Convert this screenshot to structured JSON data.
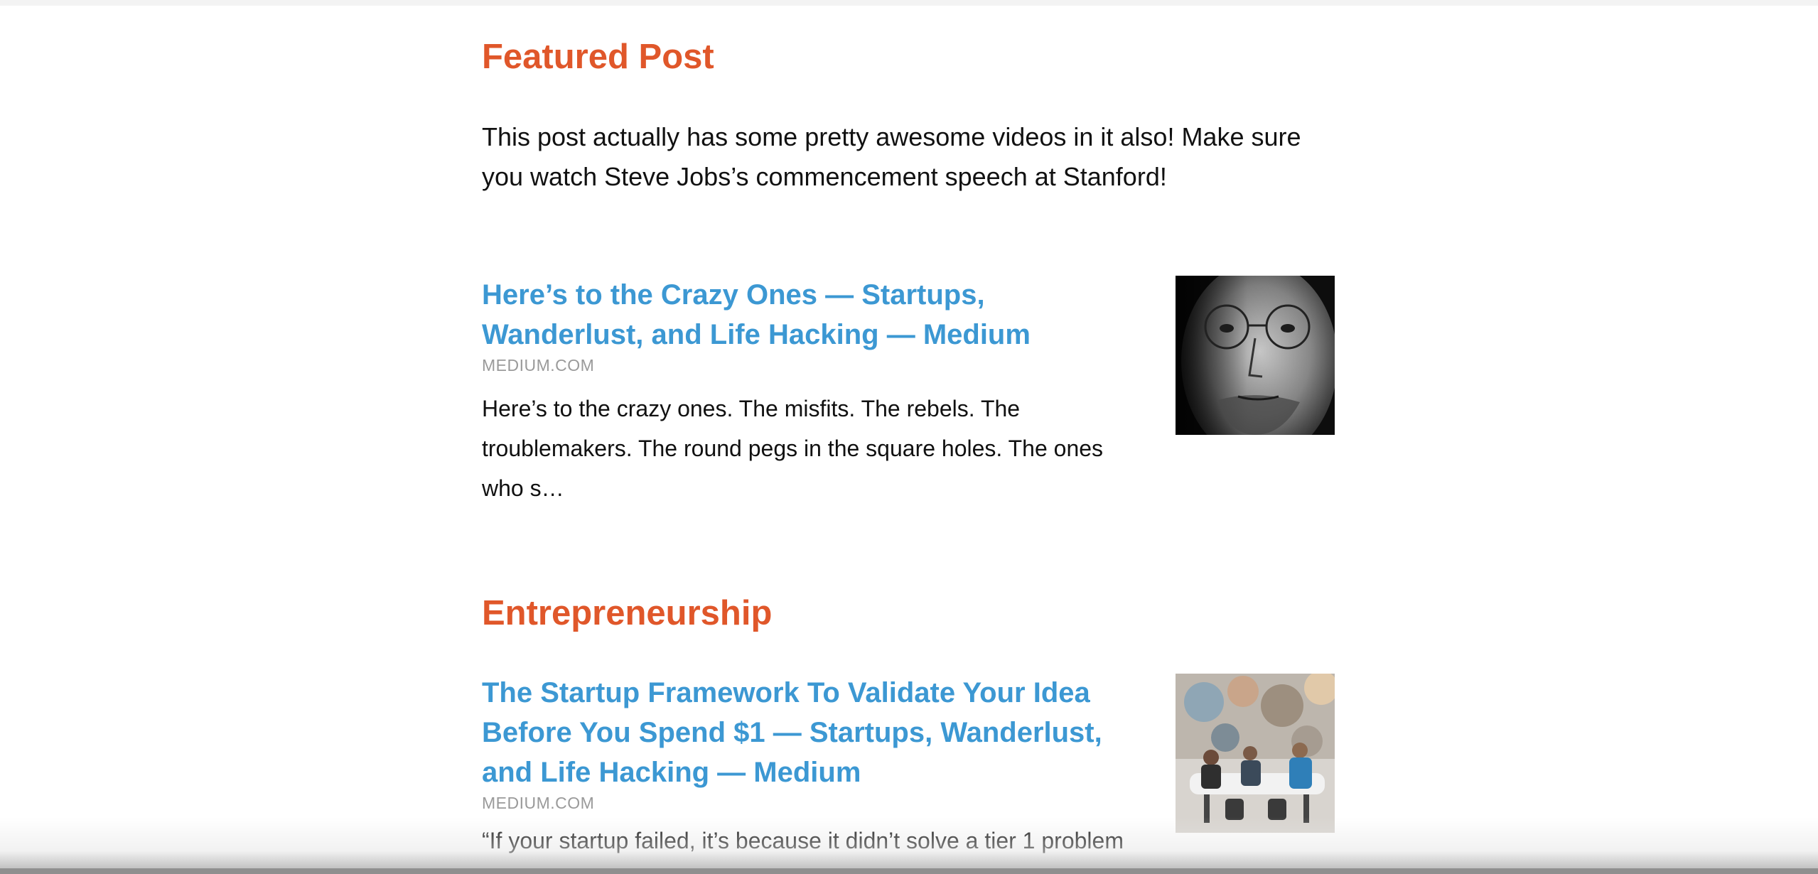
{
  "featured": {
    "heading": "Featured Post",
    "intro": "This post actually has some pretty awesome videos in it also! Make sure you watch Steve Jobs’s commencement speech at Stanford!",
    "card": {
      "title": "Here’s to the Crazy Ones — Startups, Wanderlust, and Life Hacking — Medium",
      "source": "MEDIUM.COM",
      "excerpt": "Here’s to the crazy ones. The misfits. The rebels. The troublemakers. The round pegs in the square holes. The ones who s…",
      "thumbnail": "portrait-photo"
    }
  },
  "entrepreneurship": {
    "heading": "Entrepreneurship",
    "card": {
      "title": "The Startup Framework To Validate Your Idea Before You Spend $1 — Startups, Wanderlust, and Life Hacking — Medium",
      "source": "MEDIUM.COM",
      "excerpt": "“If your startup failed, it’s because it didn’t solve a tier 1 problem",
      "thumbnail": "office-team-photo"
    }
  },
  "colors": {
    "heading": "#e0572a",
    "link": "#3c98d3",
    "source": "#9a9a9a",
    "body_text": "#111111"
  }
}
